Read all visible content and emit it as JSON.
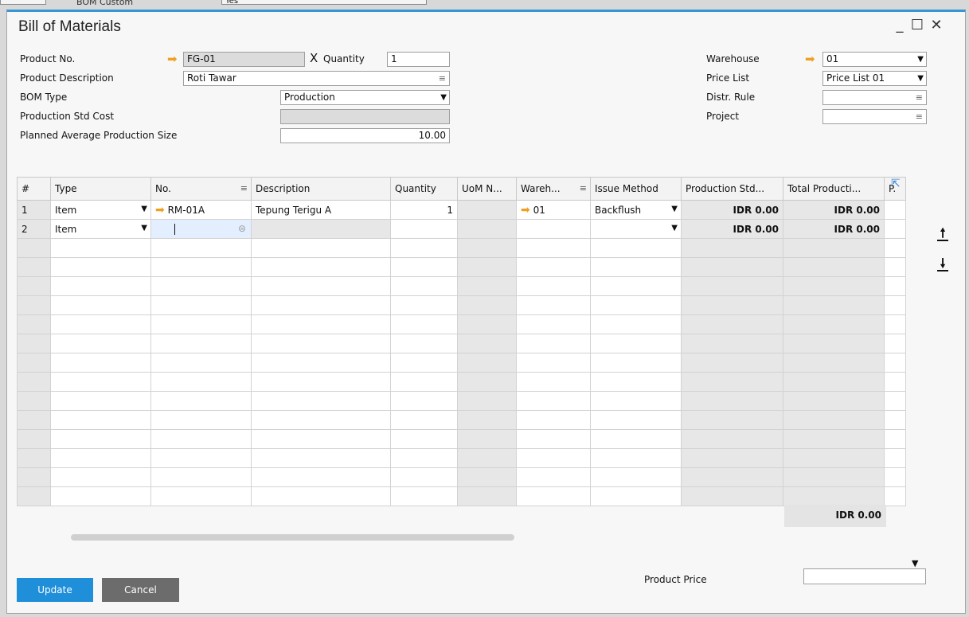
{
  "background": {
    "label": "BOM Custom",
    "value": "Yes"
  },
  "window": {
    "title": "Bill of Materials",
    "minimize": "_",
    "maximize": "☐",
    "close": "✕"
  },
  "header": {
    "product_no": {
      "label": "Product No.",
      "value": "FG-01"
    },
    "x_label": "X",
    "quantity": {
      "label": "Quantity",
      "value": "1"
    },
    "product_description": {
      "label": "Product Description",
      "value": "Roti Tawar"
    },
    "bom_type": {
      "label": "BOM Type",
      "value": "Production"
    },
    "production_std_cost": {
      "label": "Production Std Cost",
      "value": ""
    },
    "planned_avg_size": {
      "label": "Planned Average Production Size",
      "value": "10.00"
    },
    "warehouse": {
      "label": "Warehouse",
      "value": "01"
    },
    "price_list": {
      "label": "Price List",
      "value": "Price List 01"
    },
    "distr_rule": {
      "label": "Distr. Rule",
      "value": ""
    },
    "project": {
      "label": "Project",
      "value": ""
    }
  },
  "grid": {
    "columns": [
      "#",
      "Type",
      "No.",
      "Description",
      "Quantity",
      "UoM N...",
      "Wareh...",
      "Issue Method",
      "Production Std...",
      "Total Producti...",
      "P."
    ],
    "rows": [
      {
        "num": "1",
        "type": "Item",
        "no": "RM-01A",
        "description": "Tepung Terigu A",
        "quantity": "1",
        "uom": "",
        "warehouse": "01",
        "issue_method": "Backflush",
        "std_cost": "IDR 0.00",
        "total": "IDR 0.00"
      },
      {
        "num": "2",
        "type": "Item",
        "no": "",
        "description": "",
        "quantity": "",
        "uom": "",
        "warehouse": "",
        "issue_method": "",
        "std_cost": "IDR 0.00",
        "total": "IDR 0.00"
      }
    ],
    "total": "IDR 0.00"
  },
  "footer": {
    "update_label": "Update",
    "cancel_label": "Cancel",
    "product_price": {
      "label": "Product Price",
      "value": ""
    }
  },
  "icons": {
    "link_arrow": "orange-link-arrow-icon",
    "move_up": "arrow-up-icon",
    "move_down": "arrow-down-icon",
    "expand": "expand-icon"
  },
  "colors": {
    "accent": "#3797d3",
    "update_button": "#1f8fda",
    "cancel_button": "#6c6c6c",
    "link_arrow": "#f0a020"
  }
}
